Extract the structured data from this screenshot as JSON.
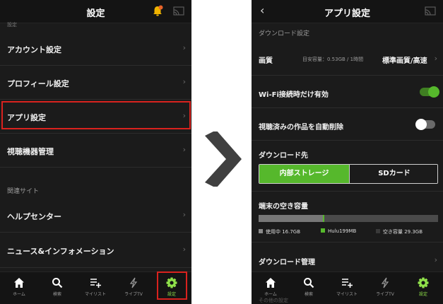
{
  "left_screen": {
    "title": "設定",
    "cut_section_label": "設定",
    "menu_items": [
      {
        "label": "アカウント設定"
      },
      {
        "label": "プロフィール設定"
      },
      {
        "label": "アプリ設定"
      },
      {
        "label": "視聴機器管理"
      }
    ],
    "section_related": "関連サイト",
    "related_items": [
      {
        "label": "ヘルプセンター"
      },
      {
        "label": "ニュース&インフォメーション"
      }
    ],
    "chevron": "›"
  },
  "right_screen": {
    "back": "‹",
    "title": "アプリ設定",
    "section_download_settings": "ダウンロード設定",
    "quality": {
      "label": "画質",
      "estimate": "目安容量：0.53GB / 1時間",
      "value": "標準画質/高速",
      "chevron": "›"
    },
    "wifi_only": {
      "label": "Wi-Fi接続時だけ有効",
      "on": true
    },
    "auto_delete": {
      "label": "視聴済みの作品を自動削除",
      "on": false
    },
    "destination": {
      "label": "ダウンロード先",
      "options": [
        "内部ストレージ",
        "SDカード"
      ],
      "selected": "内部ストレージ"
    },
    "free_space": {
      "label": "端末の空き容量",
      "used_fraction": 0.36,
      "hulu_fraction": 0.005,
      "legend": [
        {
          "label": "使用中 16.7GB",
          "color": "#8a8a8a"
        },
        {
          "label": "Hulu199MB",
          "color": "#56b82c"
        },
        {
          "label": "空き容量 29.3GB",
          "color": "#3a3a3a"
        }
      ]
    },
    "download_manage": {
      "label": "ダウンロード管理",
      "chevron": "›"
    },
    "overflow_label": "その他の設定"
  },
  "bottom_nav": [
    {
      "label": "ホーム",
      "icon": "home-icon"
    },
    {
      "label": "検索",
      "icon": "search-icon"
    },
    {
      "label": "マイリスト",
      "icon": "mylist-icon"
    },
    {
      "label": "ライブTV",
      "icon": "live-tv-icon"
    },
    {
      "label": "設定",
      "icon": "gear-icon",
      "active": true
    }
  ],
  "colors": {
    "accent_green": "#56b82c",
    "highlight_red": "#d9221e",
    "bell_yellow": "#f0b400",
    "notification_dot": "#e8632a"
  }
}
